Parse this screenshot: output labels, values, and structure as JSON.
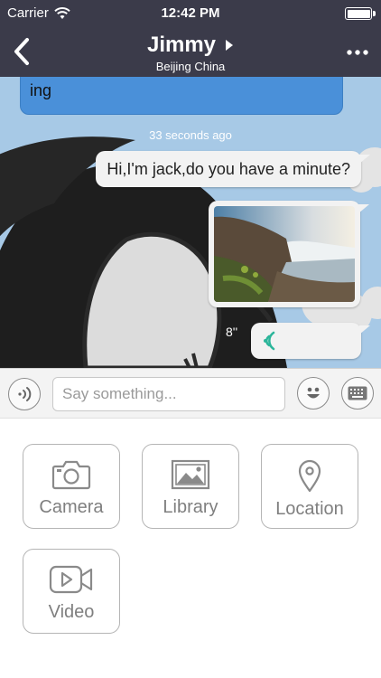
{
  "status_bar": {
    "carrier": "Carrier",
    "time": "12:42 PM"
  },
  "nav": {
    "title": "Jimmy",
    "subtitle": "Beijing China",
    "bar_color": "#3b3b4a"
  },
  "chat": {
    "messages": [
      {
        "type": "text",
        "side": "left",
        "text": "ing",
        "color": "#4a90d9"
      },
      {
        "type": "timestamp",
        "text": "33 seconds ago"
      },
      {
        "type": "text",
        "side": "right",
        "text": "Hi,I'm jack,do you have a minute?"
      },
      {
        "type": "image",
        "side": "right",
        "content": "waterfall landscape photo"
      },
      {
        "type": "voice",
        "side": "right",
        "duration": "8''"
      }
    ]
  },
  "input_bar": {
    "placeholder": "Say something...",
    "value": ""
  },
  "attachments": [
    {
      "label": "Camera",
      "icon": "camera-icon"
    },
    {
      "label": "Library",
      "icon": "image-library-icon"
    },
    {
      "label": "Location",
      "icon": "location-pin-icon"
    },
    {
      "label": "Video",
      "icon": "video-camera-icon"
    }
  ]
}
